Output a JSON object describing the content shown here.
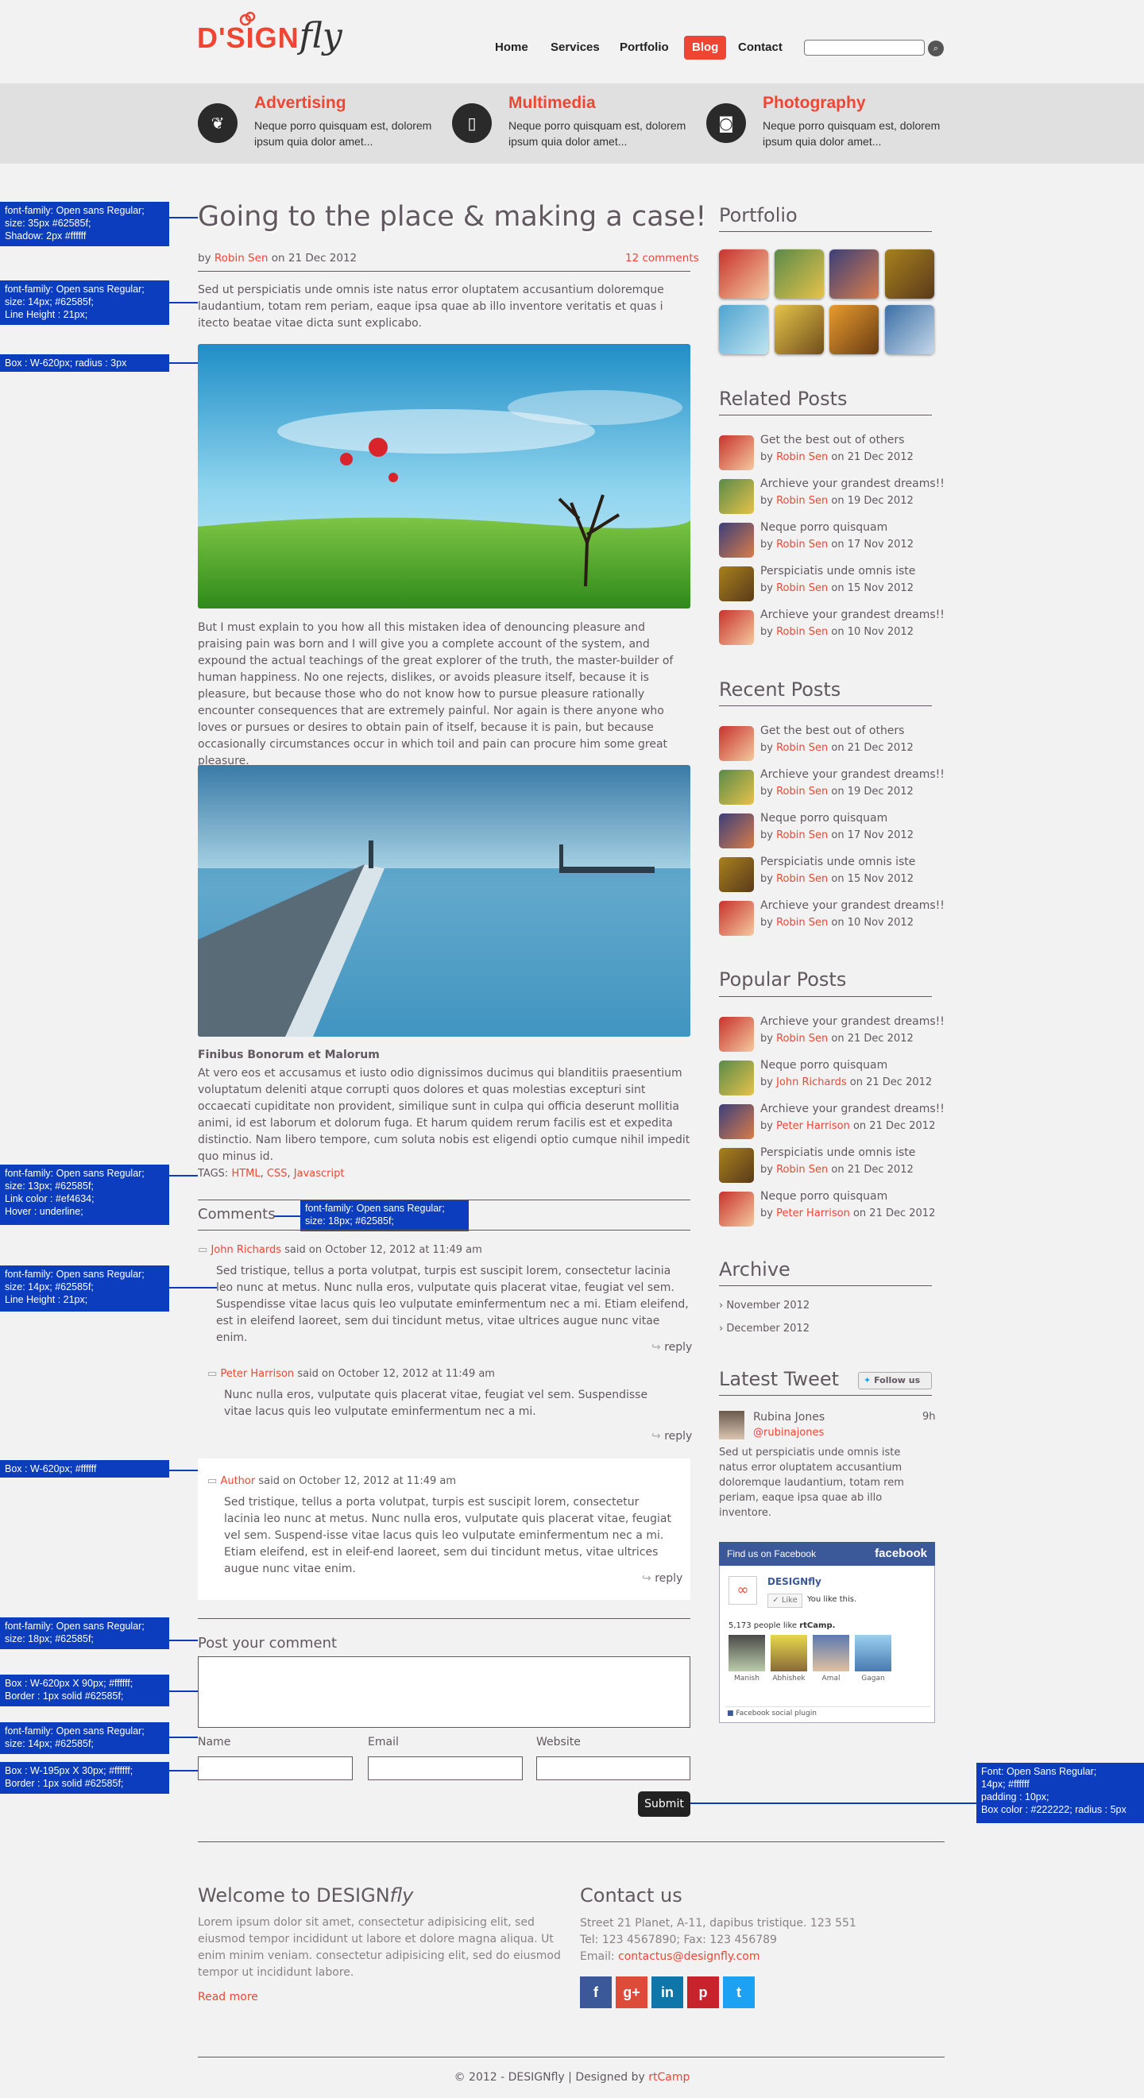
{
  "header": {
    "logo_main": "D'SIGN",
    "logo_fly": "fly",
    "nav": [
      "Home",
      "Services",
      "Portfolio",
      "Blog",
      "Contact"
    ],
    "search_placeholder": ""
  },
  "services": [
    {
      "title": "Advertising",
      "text": "Neque porro quisquam est, dolorem ipsum quia dolor amet...",
      "icon": "leaf-icon"
    },
    {
      "title": "Multimedia",
      "text": "Neque porro quisquam est, dolorem ipsum quia dolor amet...",
      "icon": "phone-icon"
    },
    {
      "title": "Photography",
      "text": "Neque porro quisquam est, dolorem ipsum quia dolor amet...",
      "icon": "camera-icon"
    }
  ],
  "notes": {
    "n1": "font-family: Open sans Regular;\nsize:  35px #62585f;\nShadow: 2px #ffffff",
    "n2": "font-family: Open sans Regular;\nsize:  14px; #62585f;\nLine Height : 21px;",
    "n3": "Box : W-620px;  radius : 3px",
    "n4": "font-family: Open sans Regular;\nsize:  13px; #62585f;\nLink color : #ef4634;\nHover : underline;",
    "n5": "font-family: Open sans Regular;\nsize:  18px; #62585f;",
    "n6": "font-family: Open sans Regular;\nsize:  14px; #62585f;\nLine Height : 21px;",
    "n7": "Box : W-620px; #ffffff",
    "n8": "font-family: Open sans Regular;\nsize:  18px; #62585f;",
    "n9": "Box : W-620px X 90px; #ffffff;\nBorder : 1px solid #62585f;",
    "n10": "font-family: Open sans Regular;\nsize:  14px; #62585f;",
    "n11": "Box : W-195px X 30px; #ffffff;\nBorder : 1px solid #62585f;",
    "n12": "Font: Open Sans Regular;\n14px; #ffffff\npadding : 10px;\nBox color : #222222; radius : 5px"
  },
  "post": {
    "title": "Going to the place & making a case!",
    "by": "by",
    "author": "Robin Sen",
    "on_date": "on 21 Dec 2012",
    "comments_link": "12 comments",
    "intro": "Sed ut perspiciatis unde omnis iste natus error oluptatem accusantium doloremque laudantium, totam rem periam, eaque ipsa quae ab illo inventore veritatis et quas i itecto beatae vitae dicta sunt explicabo.",
    "body": "But I must explain to you how all this mistaken idea of denouncing pleasure and praising pain was born and I will give you a complete account of the system, and expound the actual teachings of the great explorer of the truth, the master-builder of human happiness. No one rejects, dislikes, or avoids pleasure itself, because it is pleasure, but because those who do not know how to pursue pleasure rationally encounter consequences that are extremely painful. Nor again is there anyone who loves or pursues or desires to obtain pain of itself, because it is pain, but because occasionally circumstances occur in which toil and pain can procure him some great pleasure.",
    "sub_title": "Finibus Bonorum et Malorum",
    "sub_body": "At vero eos et accusamus et iusto odio dignissimos ducimus qui blanditiis praesentium voluptatum deleniti atque corrupti quos dolores et quas molestias excepturi sint occaecati cupiditate non provident, similique sunt in culpa qui officia deserunt mollitia animi, id est laborum et dolorum fuga. Et harum quidem rerum facilis est et expedita distinctio. Nam libero tempore, cum soluta nobis est eligendi optio cumque nihil impedit quo minus id.",
    "tags_label": "TAGS:",
    "tags": [
      "HTML",
      "CSS",
      "Javascript"
    ]
  },
  "comments": {
    "heading": "Comments",
    "items": [
      {
        "name": "John Richards",
        "said": "said on October 12, 2012 at 11:49 am",
        "text": "Sed tristique, tellus a porta volutpat, turpis est suscipit lorem, consectetur lacinia leo nunc at metus. Nunc nulla eros, vulputate quis placerat vitae, feugiat vel sem. Suspendisse vitae lacus quis leo vulputate eminfermentum nec a mi. Etiam eleifend, est in eleifend laoreet, sem dui tincidunt metus, vitae ultrices augue nunc vitae enim.",
        "reply": "reply"
      },
      {
        "name": "Peter Harrison",
        "said": "said on October 12, 2012 at 11:49 am",
        "text": "Nunc nulla eros, vulputate quis placerat vitae, feugiat vel sem. Suspendisse vitae lacus quis leo vulputate eminfermentum nec a mi.",
        "reply": "reply"
      },
      {
        "name": "Author",
        "said": "said on October 12, 2012 at 11:49 am",
        "text": "Sed tristique, tellus a porta volutpat, turpis est suscipit lorem, consectetur lacinia leo nunc at metus. Nunc nulla eros, vulputate quis placerat vitae, feugiat vel sem. Suspend-isse vitae lacus quis leo vulputate eminfermentum nec a mi. Etiam eleifend, est in eleif-end laoreet, sem dui tincidunt metus, vitae ultrices augue nunc vitae enim.",
        "reply": "reply"
      }
    ]
  },
  "form": {
    "heading": "Post your comment",
    "name_label": "Name",
    "email_label": "Email",
    "website_label": "Website",
    "submit": "Submit"
  },
  "sidebar": {
    "portfolio": "Portfolio",
    "related": "Related Posts",
    "recent": "Recent Posts",
    "popular": "Popular Posts",
    "archive": "Archive",
    "archive_items": [
      "› November 2012",
      "› December 2012"
    ],
    "latest_tweet": "Latest Tweet",
    "follow": "Follow us",
    "tweet_name": "Rubina Jones",
    "tweet_handle": "@rubinajones",
    "tweet_time": "9h",
    "tweet_text": "Sed ut perspiciatis unde omnis iste natus error oluptatem accusantium doloremque laudantium, totam rem periam, eaque ipsa quae ab illo inventore.",
    "post_lists": {
      "related": [
        {
          "title": "Get the best out of others",
          "author": "Robin Sen",
          "date": "on 21 Dec 2012"
        },
        {
          "title": "Archieve your grandest dreams!!",
          "author": "Robin Sen",
          "date": "on 19 Dec 2012"
        },
        {
          "title": "Neque porro quisquam",
          "author": "Robin Sen",
          "date": "on 17 Nov 2012"
        },
        {
          "title": "Perspiciatis unde omnis iste",
          "author": "Robin Sen",
          "date": "on 15 Nov 2012"
        },
        {
          "title": "Archieve your grandest dreams!!",
          "author": "Robin Sen",
          "date": "on 10 Nov 2012"
        }
      ],
      "recent": [
        {
          "title": "Get the best out of others",
          "author": "Robin Sen",
          "date": "on 21 Dec 2012"
        },
        {
          "title": "Archieve your grandest dreams!!",
          "author": "Robin Sen",
          "date": "on 19 Dec 2012"
        },
        {
          "title": "Neque porro quisquam",
          "author": "Robin Sen",
          "date": "on 17 Nov 2012"
        },
        {
          "title": "Perspiciatis unde omnis iste",
          "author": "Robin Sen",
          "date": "on 15 Nov 2012"
        },
        {
          "title": "Archieve your grandest dreams!!",
          "author": "Robin Sen",
          "date": "on 10 Nov 2012"
        }
      ],
      "popular": [
        {
          "title": "Archieve your grandest dreams!!",
          "author": "Robin Sen",
          "date": "on 21 Dec 2012"
        },
        {
          "title": "Neque porro quisquam",
          "author": "John Richards",
          "date": "on 21 Dec 2012"
        },
        {
          "title": "Archieve your grandest dreams!!",
          "author": "Peter Harrison",
          "date": "on 21 Dec 2012"
        },
        {
          "title": "Perspiciatis unde omnis iste",
          "author": "Robin Sen",
          "date": "on 21 Dec 2012"
        },
        {
          "title": "Neque porro quisquam",
          "author": "Peter Harrison",
          "date": "on 21 Dec 2012"
        }
      ]
    },
    "by": "by",
    "fb": {
      "header": "Find us on Facebook",
      "brand": "facebook",
      "page": "DESIGNfly",
      "like": "Like",
      "you_like": "You like this.",
      "count": "5,173 people like",
      "count_name": "rtCamp.",
      "fans": [
        "Manish",
        "Abhishek",
        "Amal",
        "Gagan"
      ],
      "plugin": "Facebook social plugin"
    }
  },
  "footer": {
    "welcome": "Welcome to DESIGN",
    "welcome_fly": "fly",
    "welcome_text": "Lorem ipsum dolor sit amet, consectetur adipisicing elit, sed  eiusmod tempor incididunt ut labore et dolore magna aliqua. Ut enim minim veniam. consectetur adipisicing elit, sed do eiusmod tempor ut incididunt labore.",
    "read_more": "Read more",
    "contact": "Contact us",
    "address": "Street 21 Planet, A-11, dapibus tristique. 123 551",
    "tel": "Tel: 123 4567890; Fax: 123 456789",
    "email_label": "Email:",
    "email": "contactus@designfly.com",
    "copyright": "© 2012 - DESIGNfly | Designed by",
    "designer": "rtCamp",
    "social": [
      "f",
      "g+",
      "in",
      "p",
      "t"
    ],
    "social_colors": [
      "#3b5998",
      "#dd4b39",
      "#0e76a8",
      "#c8232c",
      "#1da1f2"
    ]
  }
}
